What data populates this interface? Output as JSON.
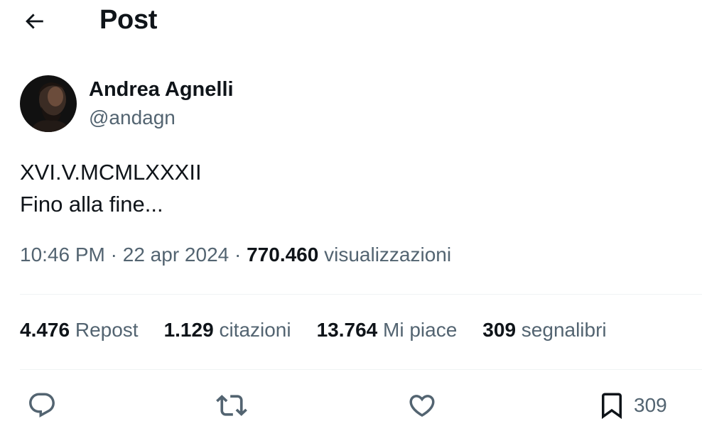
{
  "header": {
    "title": "Post",
    "back_icon": "arrow-left-icon"
  },
  "author": {
    "name": "Andrea Agnelli",
    "handle": "@andagn"
  },
  "post": {
    "lines": [
      "XVI.V.MCMLXXXII",
      "Fino alla fine..."
    ]
  },
  "meta": {
    "time": "10:46 PM",
    "separator": "·",
    "date": "22 apr 2024",
    "views_count": "770.460",
    "views_label": "visualizzazioni"
  },
  "stats": [
    {
      "count": "4.476",
      "label": "Repost"
    },
    {
      "count": "1.129",
      "label": "citazioni"
    },
    {
      "count": "13.764",
      "label": "Mi piace"
    },
    {
      "count": "309",
      "label": "segnalibri"
    }
  ],
  "actions": {
    "reply": {
      "icon": "reply-icon"
    },
    "repost": {
      "icon": "repost-icon"
    },
    "like": {
      "icon": "heart-icon"
    },
    "bookmark": {
      "icon": "bookmark-icon",
      "count": "309"
    }
  },
  "colors": {
    "text": "#0f1419",
    "secondary": "#536471",
    "divider": "#eff3f4"
  }
}
